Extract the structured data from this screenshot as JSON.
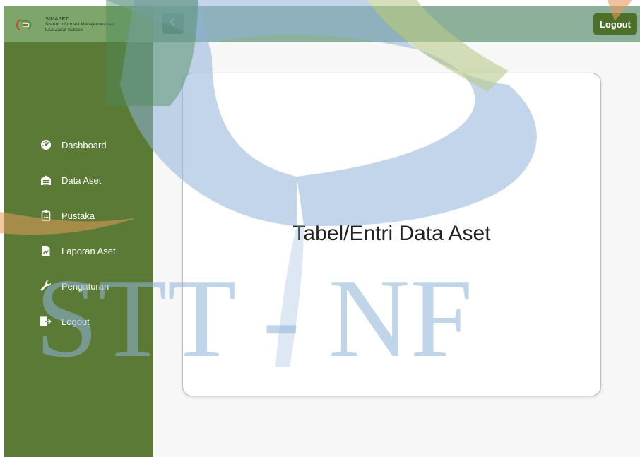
{
  "brand": {
    "name": "SIMASET",
    "subtitle": "Sistem Informasi Manajemen Aset",
    "org": "LAZ Zakat Sukses"
  },
  "topbar": {
    "back_icon": "chevron-left-icon",
    "logout_label": "Logout"
  },
  "sidebar": {
    "items": [
      {
        "label": "Dashboard",
        "icon": "gauge-icon"
      },
      {
        "label": "Data Aset",
        "icon": "warehouse-icon"
      },
      {
        "label": "Pustaka",
        "icon": "clipboard-icon"
      },
      {
        "label": "Laporan Aset",
        "icon": "report-icon"
      },
      {
        "label": "Pengaturan",
        "icon": "wrench-icon"
      },
      {
        "label": "Logout",
        "icon": "sign-out-icon"
      }
    ]
  },
  "main": {
    "card_title": "Tabel/Entri Data Aset"
  },
  "watermark": {
    "text": "STT - NF"
  },
  "colors": {
    "sidebar": "#5a7a36",
    "sidebar_header": "#7fa66a",
    "topbar": "#8db09b",
    "back_button": "#3f7256",
    "logout_button": "#4e6f2a",
    "watermark_blue": "#8fb3d9",
    "watermark_green": "#b9c98a",
    "watermark_orange": "#e39a5a"
  }
}
